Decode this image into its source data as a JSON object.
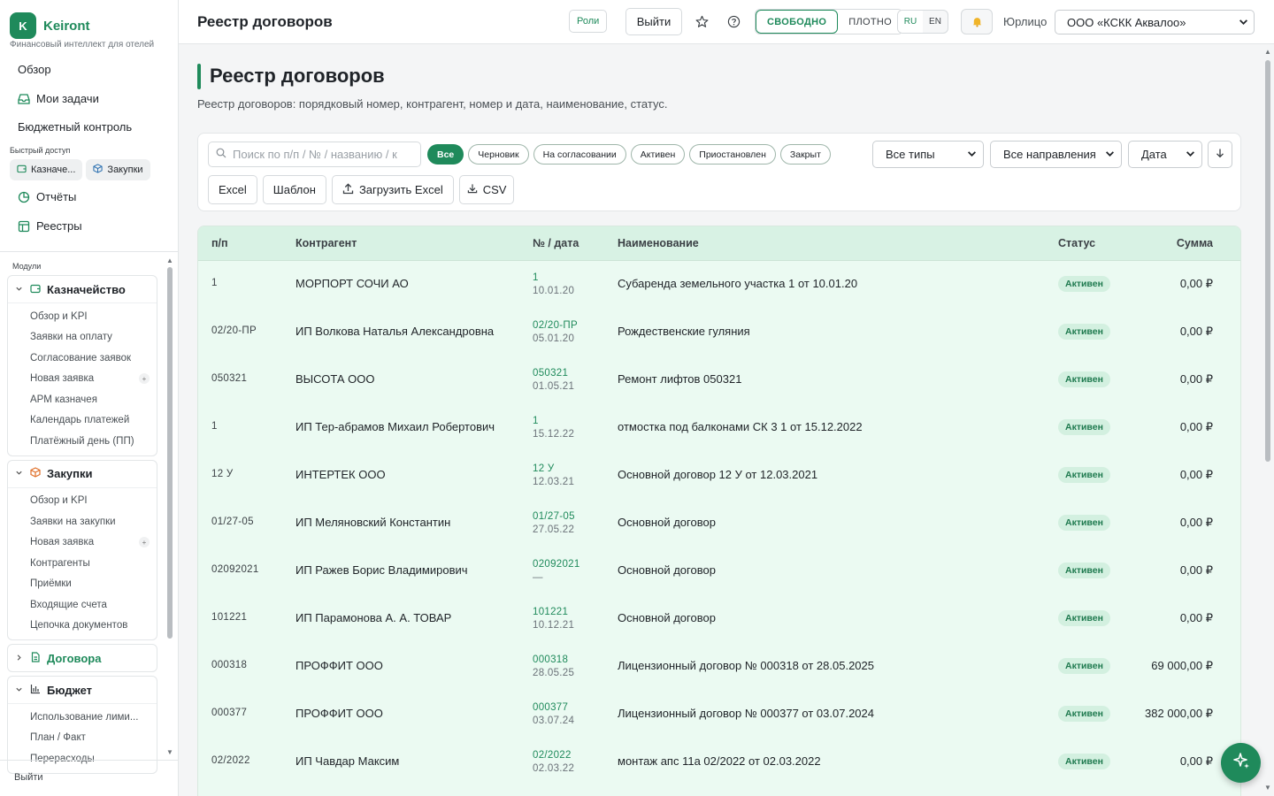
{
  "brand": {
    "logo_letter": "K",
    "name": "Keiront",
    "tagline": "Финансовый интеллект для отелей"
  },
  "sidebar": {
    "nav": [
      {
        "label": "Обзор"
      },
      {
        "label": "Мои задачи",
        "icon": "inbox-icon"
      },
      {
        "label": "Бюджетный контроль"
      }
    ],
    "quick_access_label": "Быстрый доступ",
    "quick_access": [
      {
        "label": "Казначе...",
        "icon": "wallet-icon"
      },
      {
        "label": "Закупки",
        "icon": "box-icon"
      }
    ],
    "nav2": [
      {
        "label": "Отчёты",
        "icon": "pie-chart-icon"
      },
      {
        "label": "Реестры",
        "icon": "table-icon"
      }
    ],
    "modules_label": "Модули",
    "modules": [
      {
        "label": "Казначейство",
        "expanded": true,
        "icon": "wallet-icon",
        "items": [
          "Обзор и KPI",
          "Заявки на оплату",
          "Согласование заявок",
          "Новая заявка",
          "АРМ казначея",
          "Календарь платежей",
          "Платёжный день (ПП)"
        ]
      },
      {
        "label": "Закупки",
        "expanded": true,
        "icon": "box-icon",
        "items": [
          "Обзор и KPI",
          "Заявки на закупки",
          "Новая заявка",
          "Контрагенты",
          "Приёмки",
          "Входящие счета",
          "Цепочка документов"
        ]
      },
      {
        "label": "Договора",
        "expanded": false,
        "icon": "document-icon",
        "active": true
      },
      {
        "label": "Бюджет",
        "expanded": true,
        "icon": "bar-chart-icon",
        "items": [
          "Использование лими...",
          "План / Факт",
          "Перерасходы"
        ]
      }
    ],
    "logout": "Выйти"
  },
  "topbar": {
    "title": "Реестр договоров",
    "roles": "Роли",
    "logout": "Выйти",
    "density": [
      "СВОБОДНО",
      "ПЛОТНО"
    ],
    "density_active": 0,
    "langs": [
      "RU",
      "EN"
    ],
    "lang_active": 0,
    "entity_label": "Юрлицо",
    "entity_value": "ООО «КСКК Аквалоо»"
  },
  "page": {
    "title": "Реестр договоров",
    "description": "Реестр договоров: порядковый номер, контрагент, номер и дата, наименование, статус."
  },
  "filters": {
    "search_placeholder": "Поиск по п/п / № / названию / к",
    "status_chips": [
      "Все",
      "Черновик",
      "На согласовании",
      "Активен",
      "Приостановлен",
      "Закрыт"
    ],
    "status_active": "Все",
    "type_select": "Все типы",
    "direction_select": "Все направления",
    "sort_select": "Дата",
    "actions": [
      "Excel",
      "Шаблон",
      "Загрузить Excel",
      "CSV"
    ]
  },
  "table": {
    "columns": [
      "п/п",
      "Контрагент",
      "№ / дата",
      "Наименование",
      "Статус",
      "Сумма"
    ],
    "rows": [
      {
        "num": "1",
        "counterparty": "МОРПОРТ СОЧИ АО",
        "doc_no": "1",
        "doc_date": "10.01.20",
        "name": "Субаренда земельного участка 1 от 10.01.20",
        "status": "Активен",
        "sum": "0,00 ₽"
      },
      {
        "num": "02/20-ПР",
        "counterparty": "ИП Волкова Наталья Александровна",
        "doc_no": "02/20-ПР",
        "doc_date": "05.01.20",
        "name": "Рождественские гуляния",
        "status": "Активен",
        "sum": "0,00 ₽"
      },
      {
        "num": "050321",
        "counterparty": "ВЫСОТА ООО",
        "doc_no": "050321",
        "doc_date": "01.05.21",
        "name": "Ремонт лифтов 050321",
        "status": "Активен",
        "sum": "0,00 ₽"
      },
      {
        "num": "1",
        "counterparty": "ИП Тер-абрамов Михаил Робертович",
        "doc_no": "1",
        "doc_date": "15.12.22",
        "name": "отмостка под балконами СК 3 1 от 15.12.2022",
        "status": "Активен",
        "sum": "0,00 ₽"
      },
      {
        "num": "12 У",
        "counterparty": "ИНТЕРТЕК ООО",
        "doc_no": "12 У",
        "doc_date": "12.03.21",
        "name": "Основной договор 12 У от 12.03.2021",
        "status": "Активен",
        "sum": "0,00 ₽"
      },
      {
        "num": "01/27-05",
        "counterparty": "ИП Меляновский Константин",
        "doc_no": "01/27-05",
        "doc_date": "27.05.22",
        "name": "Основной договор",
        "status": "Активен",
        "sum": "0,00 ₽"
      },
      {
        "num": "02092021",
        "counterparty": "ИП Ражев Борис Владимирович",
        "doc_no": "02092021",
        "doc_date": "—",
        "name": "Основной договор",
        "status": "Активен",
        "sum": "0,00 ₽"
      },
      {
        "num": "101221",
        "counterparty": "ИП Парамонова А. А. ТОВАР",
        "doc_no": "101221",
        "doc_date": "10.12.21",
        "name": "Основной договор",
        "status": "Активен",
        "sum": "0,00 ₽"
      },
      {
        "num": "000318",
        "counterparty": "ПРОФФИТ ООО",
        "doc_no": "000318",
        "doc_date": "28.05.25",
        "name": "Лицензионный договор № 000318 от 28.05.2025",
        "status": "Активен",
        "sum": "69 000,00 ₽"
      },
      {
        "num": "000377",
        "counterparty": "ПРОФФИТ ООО",
        "doc_no": "000377",
        "doc_date": "03.07.24",
        "name": "Лицензионный договор № 000377 от 03.07.2024",
        "status": "Активен",
        "sum": "382 000,00 ₽"
      },
      {
        "num": "02/2022",
        "counterparty": "ИП Чавдар Максим",
        "doc_no": "02/2022",
        "doc_date": "02.03.22",
        "name": "монтаж апс 11а 02/2022 от 02.03.2022",
        "status": "Активен",
        "sum": "0,00 ₽"
      }
    ]
  },
  "colors": {
    "accent": "#1f8a5b",
    "row_bg": "#ebfaf2",
    "header_bg": "#d8f2e4",
    "badge_bg": "#d3f0e0"
  }
}
